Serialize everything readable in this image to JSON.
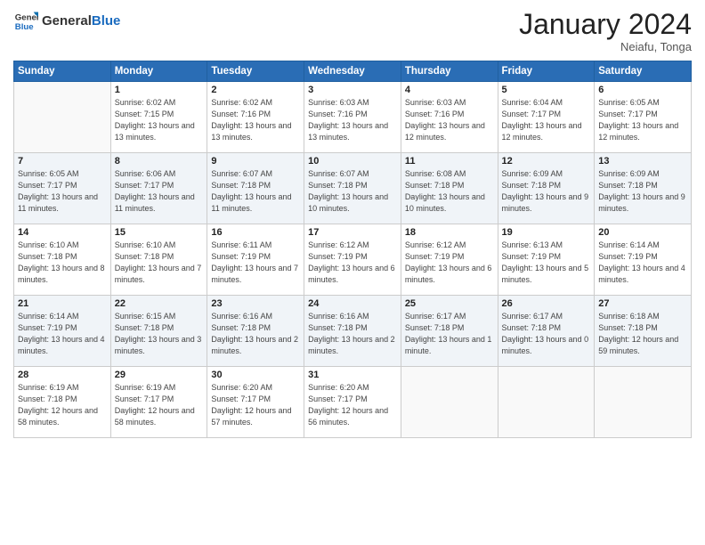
{
  "header": {
    "logo_general": "General",
    "logo_blue": "Blue",
    "month_title": "January 2024",
    "location": "Neiafu, Tonga"
  },
  "days_of_week": [
    "Sunday",
    "Monday",
    "Tuesday",
    "Wednesday",
    "Thursday",
    "Friday",
    "Saturday"
  ],
  "weeks": [
    [
      {
        "day": "",
        "info": ""
      },
      {
        "day": "1",
        "info": "Sunrise: 6:02 AM\nSunset: 7:15 PM\nDaylight: 13 hours and 13 minutes."
      },
      {
        "day": "2",
        "info": "Sunrise: 6:02 AM\nSunset: 7:16 PM\nDaylight: 13 hours and 13 minutes."
      },
      {
        "day": "3",
        "info": "Sunrise: 6:03 AM\nSunset: 7:16 PM\nDaylight: 13 hours and 13 minutes."
      },
      {
        "day": "4",
        "info": "Sunrise: 6:03 AM\nSunset: 7:16 PM\nDaylight: 13 hours and 12 minutes."
      },
      {
        "day": "5",
        "info": "Sunrise: 6:04 AM\nSunset: 7:17 PM\nDaylight: 13 hours and 12 minutes."
      },
      {
        "day": "6",
        "info": "Sunrise: 6:05 AM\nSunset: 7:17 PM\nDaylight: 13 hours and 12 minutes."
      }
    ],
    [
      {
        "day": "7",
        "info": "Sunrise: 6:05 AM\nSunset: 7:17 PM\nDaylight: 13 hours and 11 minutes."
      },
      {
        "day": "8",
        "info": "Sunrise: 6:06 AM\nSunset: 7:17 PM\nDaylight: 13 hours and 11 minutes."
      },
      {
        "day": "9",
        "info": "Sunrise: 6:07 AM\nSunset: 7:18 PM\nDaylight: 13 hours and 11 minutes."
      },
      {
        "day": "10",
        "info": "Sunrise: 6:07 AM\nSunset: 7:18 PM\nDaylight: 13 hours and 10 minutes."
      },
      {
        "day": "11",
        "info": "Sunrise: 6:08 AM\nSunset: 7:18 PM\nDaylight: 13 hours and 10 minutes."
      },
      {
        "day": "12",
        "info": "Sunrise: 6:09 AM\nSunset: 7:18 PM\nDaylight: 13 hours and 9 minutes."
      },
      {
        "day": "13",
        "info": "Sunrise: 6:09 AM\nSunset: 7:18 PM\nDaylight: 13 hours and 9 minutes."
      }
    ],
    [
      {
        "day": "14",
        "info": "Sunrise: 6:10 AM\nSunset: 7:18 PM\nDaylight: 13 hours and 8 minutes."
      },
      {
        "day": "15",
        "info": "Sunrise: 6:10 AM\nSunset: 7:18 PM\nDaylight: 13 hours and 7 minutes."
      },
      {
        "day": "16",
        "info": "Sunrise: 6:11 AM\nSunset: 7:19 PM\nDaylight: 13 hours and 7 minutes."
      },
      {
        "day": "17",
        "info": "Sunrise: 6:12 AM\nSunset: 7:19 PM\nDaylight: 13 hours and 6 minutes."
      },
      {
        "day": "18",
        "info": "Sunrise: 6:12 AM\nSunset: 7:19 PM\nDaylight: 13 hours and 6 minutes."
      },
      {
        "day": "19",
        "info": "Sunrise: 6:13 AM\nSunset: 7:19 PM\nDaylight: 13 hours and 5 minutes."
      },
      {
        "day": "20",
        "info": "Sunrise: 6:14 AM\nSunset: 7:19 PM\nDaylight: 13 hours and 4 minutes."
      }
    ],
    [
      {
        "day": "21",
        "info": "Sunrise: 6:14 AM\nSunset: 7:19 PM\nDaylight: 13 hours and 4 minutes."
      },
      {
        "day": "22",
        "info": "Sunrise: 6:15 AM\nSunset: 7:18 PM\nDaylight: 13 hours and 3 minutes."
      },
      {
        "day": "23",
        "info": "Sunrise: 6:16 AM\nSunset: 7:18 PM\nDaylight: 13 hours and 2 minutes."
      },
      {
        "day": "24",
        "info": "Sunrise: 6:16 AM\nSunset: 7:18 PM\nDaylight: 13 hours and 2 minutes."
      },
      {
        "day": "25",
        "info": "Sunrise: 6:17 AM\nSunset: 7:18 PM\nDaylight: 13 hours and 1 minute."
      },
      {
        "day": "26",
        "info": "Sunrise: 6:17 AM\nSunset: 7:18 PM\nDaylight: 13 hours and 0 minutes."
      },
      {
        "day": "27",
        "info": "Sunrise: 6:18 AM\nSunset: 7:18 PM\nDaylight: 12 hours and 59 minutes."
      }
    ],
    [
      {
        "day": "28",
        "info": "Sunrise: 6:19 AM\nSunset: 7:18 PM\nDaylight: 12 hours and 58 minutes."
      },
      {
        "day": "29",
        "info": "Sunrise: 6:19 AM\nSunset: 7:17 PM\nDaylight: 12 hours and 58 minutes."
      },
      {
        "day": "30",
        "info": "Sunrise: 6:20 AM\nSunset: 7:17 PM\nDaylight: 12 hours and 57 minutes."
      },
      {
        "day": "31",
        "info": "Sunrise: 6:20 AM\nSunset: 7:17 PM\nDaylight: 12 hours and 56 minutes."
      },
      {
        "day": "",
        "info": ""
      },
      {
        "day": "",
        "info": ""
      },
      {
        "day": "",
        "info": ""
      }
    ]
  ]
}
